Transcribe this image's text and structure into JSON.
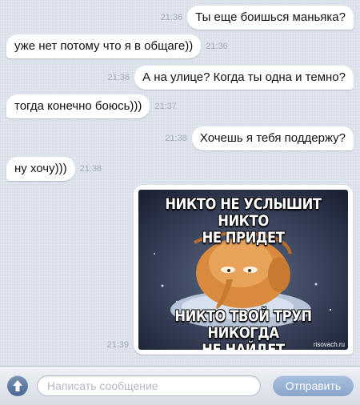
{
  "messages": [
    {
      "text": "Ты еще боишься маньяка?",
      "time": "21:36"
    },
    {
      "text": "уже нет потому что я в общаге))",
      "time": "21:36"
    },
    {
      "text": "А на улице? Когда ты одна и темно?",
      "time": "21:36"
    },
    {
      "text": "тогда конечно боюсь)))",
      "time": "21:37"
    },
    {
      "text": "Хочешь я тебя поддержу?",
      "time": "21:38"
    },
    {
      "text": "ну хочу)))",
      "time": "21:38"
    }
  ],
  "image_message": {
    "time": "21:39",
    "caption_top": "НИКТО НЕ УСЛЫШИТ НИКТО\nНЕ ПРИДЕТ",
    "caption_bottom": "НИКТО ТВОЙ ТРУП НИКОГДА\nНЕ НАЙДЕТ",
    "watermark": "risovach.ru"
  },
  "input_bar": {
    "placeholder": "Написать сообщение",
    "send_label": "Отправить",
    "attach_icon": "arrow-up-icon"
  },
  "colors": {
    "background": "#dde3ec",
    "bubble": "#ffffff",
    "time": "#a3abb6",
    "send_button": "#8aa6ca"
  }
}
